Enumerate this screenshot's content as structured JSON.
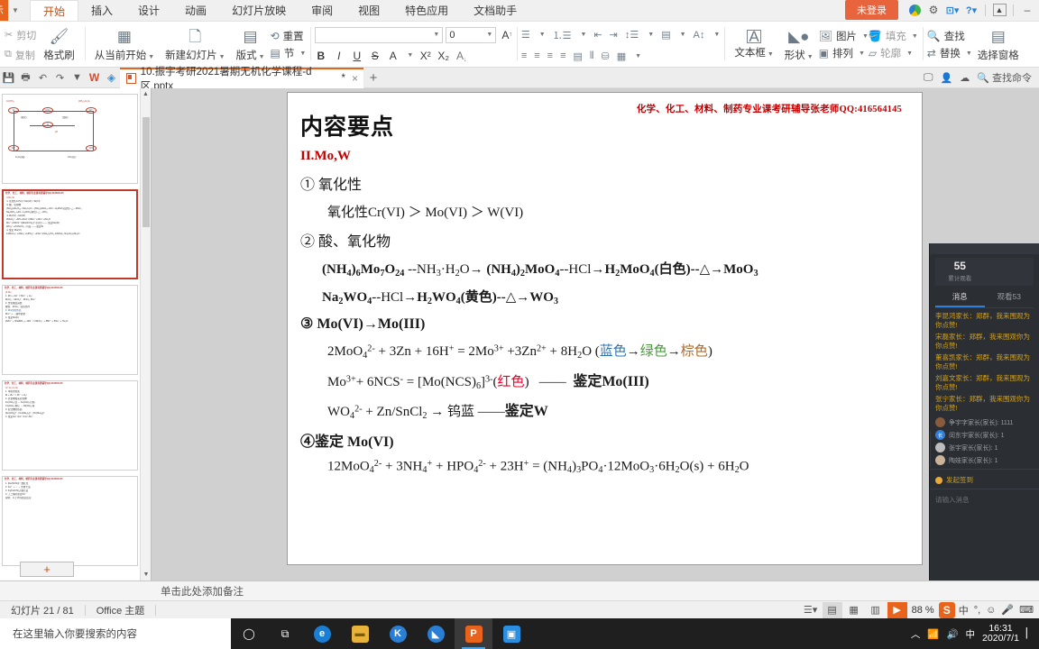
{
  "titlebar": {
    "show_button": "示",
    "ribbon_tabs": [
      "开始",
      "插入",
      "设计",
      "动画",
      "幻灯片放映",
      "审阅",
      "视图",
      "特色应用",
      "文档助手"
    ],
    "active_tab": "开始",
    "login_label": "未登录"
  },
  "ribbon": {
    "clipboard": {
      "cut": "剪切",
      "copy": "复制",
      "format_painter": "格式刷"
    },
    "slides": {
      "start_from_current": "从当前开始",
      "new_slide": "新建幻灯片",
      "layout": "版式",
      "reset": "重置",
      "section": "节"
    },
    "font": {
      "font_name": "",
      "font_size": "0",
      "bold": "B",
      "italic": "I",
      "underline": "U",
      "strike": "S",
      "text_color": "A",
      "superscript": "X²",
      "subscript": "X₂",
      "grow": "A",
      "shrink": "A"
    },
    "insert": {
      "textbox": "文本框",
      "shape": "形状",
      "picture": "图片",
      "arrange": "排列",
      "fill": "填充",
      "outline": "轮廓"
    },
    "editing": {
      "find": "查找",
      "replace": "替换",
      "select_pane": "选择窗格"
    }
  },
  "doctab": {
    "title": "10.振宇考研2021暑期无机化学课程-d区.pptx",
    "modified_marker": "*",
    "close": "×",
    "new_tab": "+",
    "find_command": "查找命令"
  },
  "slide": {
    "header_note": "化学、化工、材料、制药专业课考研辅导张老师QQ:416564145",
    "title": "内容要点",
    "section": "II.Mo,W",
    "items": [
      {
        "no": "①",
        "label": "氧化性"
      },
      {
        "no": "②",
        "label": "酸、氧化物"
      },
      {
        "no": "③",
        "label": "Mo(VI)→Mo(III)"
      },
      {
        "no": "④",
        "label": "鉴定 Mo(VI)"
      }
    ],
    "line_oxidation": "氧化性Cr(VI) ＞ Mo(VI) ＞ W(VI)",
    "eq_nh4mo_pre": "(NH4)6Mo7O24 --NH3·H2O→ (NH4)2MoO4--HCl→H2MoO4(白色)--△→MoO3",
    "eq_na2wo4": "Na2WO4--HCl→H2WO4(黄色)--△→WO3",
    "eq_moo4_zn": "2MoO4²⁻ + 3Zn + 16H⁺ = 2Mo³⁺ +3Zn²⁺ + 8H2O (蓝色→绿色→棕色)",
    "eq_mo_ncs": "Mo³⁺+ 6NCS⁻ = [Mo(NCS)6]³⁻(红色)  ——  鉴定Mo(III)",
    "eq_wo4_sncl2": "WO4²⁻ + Zn/SnCl2 → 钨蓝 ——鉴定W",
    "eq_phosphomolybdate": "12MoO4²⁻ + 3NH4⁺ + HPO4²⁻ + 23H⁺ = (NH4)3PO4·12MoO3·6H2O(s) + 6H2O",
    "colors": {
      "white": "白色",
      "yellow": "黄色",
      "blue": "蓝色",
      "green": "绿色",
      "brown": "棕色",
      "red": "红色"
    },
    "identify_mo3": "鉴定Mo(III)",
    "identify_w": "鉴定W",
    "tungsten_blue": "钨蓝"
  },
  "chat": {
    "stat_number": "55",
    "stat_label": "累计观看",
    "tabs": [
      "消息",
      "观看53"
    ],
    "active_tab": "消息",
    "messages": [
      "李昆鸿家长：郑群，我来围观为你点赞!",
      "宋磊家长：郑群，我来围观你为你点赞!",
      "董喜凯家长：郑群，我来围观为你点赞!",
      "刘嘉文家长：郑群，我来围观为你点赞!",
      "张宁家长：郑群，我来围观你为你点赞!"
    ],
    "viewers": [
      {
        "name": "争宇字家长(家长)",
        "count": "1111"
      },
      {
        "name": "闵东宇家长(家长)",
        "count": "1"
      },
      {
        "name": "张宇家长(家长)",
        "count": "1"
      },
      {
        "name": "陶娃家长(家长)",
        "count": "1"
      }
    ],
    "signin_label": "发起签到",
    "input_placeholder": "请输入消息"
  },
  "notes": {
    "placeholder": "单击此处添加备注"
  },
  "statusbar": {
    "slide_counter": "幻灯片 21 / 81",
    "theme": "Office 主题",
    "zoom": "88 %"
  },
  "taskbar": {
    "search_placeholder": "在这里输入你要搜索的内容",
    "clock_time": "16:31",
    "clock_date": "2020/7/1"
  }
}
